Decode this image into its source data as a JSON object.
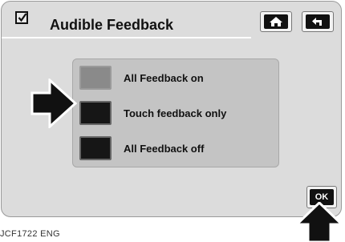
{
  "header": {
    "title": "Audible Feedback",
    "icons": [
      "checkbox-icon",
      "home-icon",
      "back-arrow-icon"
    ]
  },
  "options": [
    {
      "label": "All Feedback on",
      "selected": false
    },
    {
      "label": "Touch feedback only",
      "selected": true
    },
    {
      "label": "All Feedback off",
      "selected": true
    }
  ],
  "footer": {
    "ok_label": "OK",
    "caption": "JCF1722 ENG"
  },
  "colors": {
    "screen_bg": "#dcdcdc",
    "panel_bg": "#c4c4c4",
    "swatch_off": "#8a8a8a",
    "swatch_on": "#161616"
  }
}
